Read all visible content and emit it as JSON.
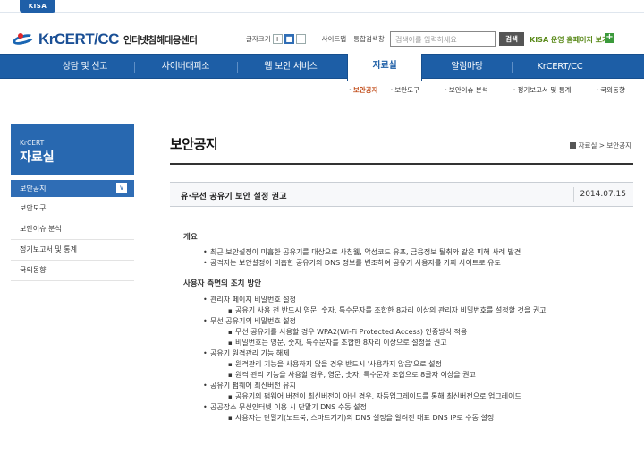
{
  "topbar": {
    "kisa_label": "KISA"
  },
  "header": {
    "logo_main": "KrCERT/CC",
    "logo_sub": "인터넷침해대응센터",
    "fontsize_label": "글자크기",
    "fontsize_buttons": [
      "+",
      "■",
      "−"
    ],
    "sitemap_label": "사이트맵",
    "search_label": "통합검색창",
    "search_placeholder": "검색어를 입력하세요",
    "search_button": "검색",
    "kisa_link": "KISA 운영 홈페이지 보기",
    "plus_icon": "+"
  },
  "nav": {
    "items": [
      "상담 및 신고",
      "사이버대피소",
      "웹 보안 서비스",
      "자료실",
      "알림마당",
      "KrCERT/CC"
    ],
    "active_index": 3,
    "colors": {
      "nav_bg": "#1d5ea6",
      "active_bg": "#ffffff"
    }
  },
  "subnav": {
    "items": [
      "보안공지",
      "보안도구",
      "보안이슈 분석",
      "정기보고서 및 통계",
      "국외동향"
    ],
    "active_index": 0,
    "bullet": "·"
  },
  "sidebar": {
    "title_en": "KrCERT",
    "title_ko": "자료실",
    "items": [
      "보안공지",
      "보안도구",
      "보안이슈 분석",
      "정기보고서 및 통계",
      "국외동향"
    ],
    "active_index": 0,
    "active_chevron": "∨"
  },
  "main": {
    "page_title": "보안공지",
    "breadcrumb": "자료실 > 보안공지",
    "article": {
      "title": "유·무선 공유기 보안 설정 권고",
      "date": "2014.07.15",
      "overview_heading": "개요",
      "overview_items": [
        "최근 보안설정이 미흡한 공유기를 대상으로 사칭웹, 악성코드 유포, 금융정보 탈취와 같은 피해 사례 발견",
        "공격자는 보안설정이 미흡한 공유기의 DNS 정보를 변조하여 공유기 사용자를 가짜 사이트로 유도"
      ],
      "measures_heading": "사용자 측면의 조치 방안",
      "measures": [
        {
          "label": "관리자 페이지 비밀번호 설정",
          "subs": [
            "공유기 사용 전 반드시 영문, 숫자, 특수문자를 조합한 8자리 이상의 관리자 비밀번호를 설정할 것을 권고"
          ]
        },
        {
          "label": "무선 공유기의 비밀번호 설정",
          "subs": [
            "무선 공유기를 사용할 경우 WPA2(Wi-Fi Protected Access) 인증방식 적용",
            "비밀번호는 영문, 숫자, 특수문자를 조합한 8자리 이상으로 설정을 권고"
          ]
        },
        {
          "label": "공유기 원격관리 기능 해제",
          "subs": [
            "원격관리 기능을 사용하지 않을 경우 반드시 '사용하지 않음'으로 설정",
            "원격 관리 기능을 사용할 경우, 영문, 숫자, 특수문자 조합으로 8글자 이상을 권고"
          ]
        },
        {
          "label": "공유기 펌웨어 최신버전 유지",
          "subs": [
            "공유기의 펌웨어 버전이 최신버전이 아닌 경우, 자동업그레이드를 통해 최신버전으로 업그레이드"
          ]
        },
        {
          "label": "공공장소 무선인터넷 이용 시 단말기 DNS 수동 설정",
          "subs": [
            "사용자는 단말기(노트북, 스마트기기)의 DNS 설정을 알려진 대표 DNS IP로 수동 설정"
          ]
        }
      ]
    }
  }
}
